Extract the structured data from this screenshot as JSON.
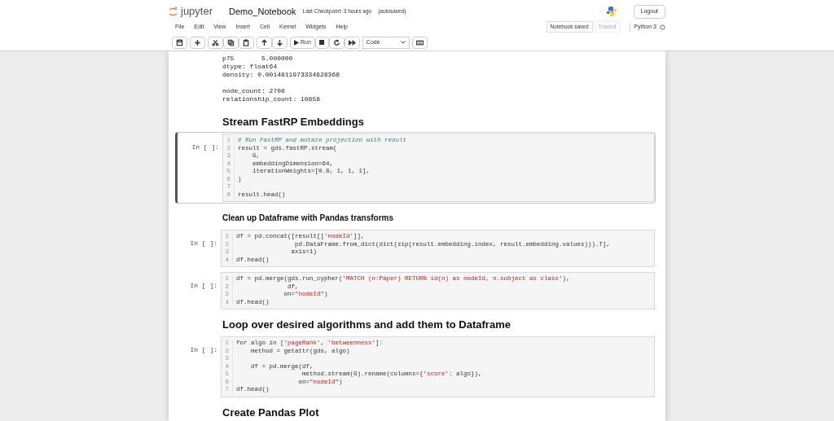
{
  "header": {
    "logo_text": "jupyter",
    "notebook_name": "Demo_Notebook",
    "checkpoint": "Last Checkpoint: 3 hours ago",
    "autosave": "(autosaved)",
    "logout": "Logout"
  },
  "menu": [
    "File",
    "Edit",
    "View",
    "Insert",
    "Cell",
    "Kernel",
    "Widgets",
    "Help"
  ],
  "status": {
    "notebook_saved": "Notebook saved",
    "trusted": "Trusted",
    "kernel": "Python 3"
  },
  "toolbar": {
    "run": "Run",
    "cell_type": "Code"
  },
  "cells": [
    {
      "kind": "output",
      "blocks": [
        [
          "p75       5.000000",
          "dtype: float64",
          "density: 0.0014811973334628368"
        ],
        [
          "node_count: 2708",
          "relationship_count: 10858"
        ]
      ]
    },
    {
      "kind": "heading_large",
      "text": "Stream FastRP Embeddings"
    },
    {
      "kind": "code",
      "prompt": "In [ ]:",
      "selected": true,
      "lines": [
        {
          "n": "1",
          "text": "# Run FastRP and mutate projection with result"
        },
        {
          "n": "2",
          "text": "result = gds.fastRP.stream("
        },
        {
          "n": "3",
          "text": "    G,"
        },
        {
          "n": "4",
          "text": "    embeddingDimension=64,"
        },
        {
          "n": "5",
          "text": "    iterationWeights=[0.8, 1, 1, 1],"
        },
        {
          "n": "6",
          "text": ")"
        },
        {
          "n": "7"
        },
        {
          "n": "8",
          "text": "result.head()"
        }
      ]
    },
    {
      "kind": "heading_small",
      "text": "Clean up Dataframe with Pandas transforms"
    },
    {
      "kind": "code",
      "prompt": "In [ ]:",
      "selected": false,
      "lines": [
        {
          "n": "1",
          "text": "df = pd.concat([result[['nodeId']],"
        },
        {
          "n": "2",
          "text": "                pd.DataFrame.from_dict(dict(zip(result.embedding.index, result.embedding.values))).T],"
        },
        {
          "n": "3",
          "text": "               axis=1)"
        },
        {
          "n": "4",
          "text": "df.head()"
        }
      ]
    },
    {
      "kind": "code",
      "prompt": "In [ ]:",
      "selected": false,
      "lines": [
        {
          "n": "1",
          "text": "df = pd.merge(gds.run_cypher('MATCH (n:Paper) RETURN id(n) as nodeId, n.subject as class'),"
        },
        {
          "n": "2",
          "text": "              df,"
        },
        {
          "n": "3",
          "text": "             on=\"nodeId\")"
        },
        {
          "n": "4",
          "text": "df.head()"
        }
      ]
    },
    {
      "kind": "heading_large",
      "text": "Loop over desired algorithms and add them to Dataframe"
    },
    {
      "kind": "code",
      "prompt": "In [ ]:",
      "selected": false,
      "lines": [
        {
          "n": "1",
          "text": "for algo in ['pageRank', 'betweenness']:"
        },
        {
          "n": "2",
          "text": "    method = getattr(gds, algo)"
        },
        {
          "n": "3"
        },
        {
          "n": "4",
          "text": "    df = pd.merge(df,"
        },
        {
          "n": "5",
          "text": "                  method.stream(G).rename(columns={'score': algo}),"
        },
        {
          "n": "6",
          "text": "                 on=\"nodeId\")"
        },
        {
          "n": "7",
          "text": "df.head()"
        }
      ]
    },
    {
      "kind": "heading_large",
      "text": "Create Pandas Plot"
    }
  ]
}
